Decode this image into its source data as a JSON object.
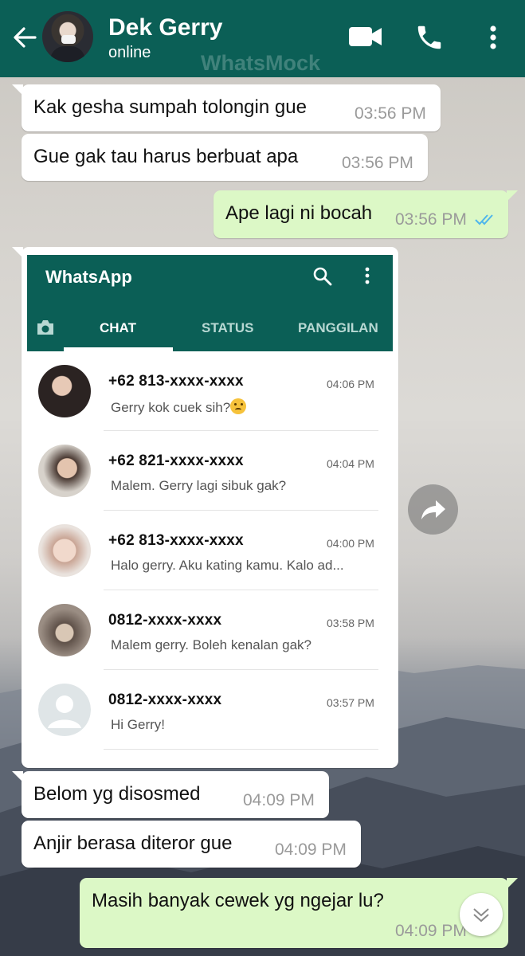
{
  "header": {
    "contact_name": "Dek Gerry",
    "status": "online",
    "watermark": "WhatsMock",
    "bg_color": "#0b5f56",
    "icons": [
      "back-arrow-icon",
      "video-call-icon",
      "voice-call-icon",
      "more-vert-icon"
    ]
  },
  "messages": [
    {
      "dir": "in",
      "text": "Kak gesha sumpah tolongin gue",
      "time": "03:56 PM"
    },
    {
      "dir": "in",
      "text": "Gue gak tau harus berbuat apa",
      "time": "03:56 PM"
    },
    {
      "dir": "out",
      "text": "Ape lagi ni bocah",
      "time": "03:56 PM",
      "read": true
    },
    {
      "dir": "in",
      "type": "image",
      "description_none": ""
    },
    {
      "dir": "in",
      "text": "Belom yg disosmed",
      "time": "04:09 PM"
    },
    {
      "dir": "in",
      "text": "Anjir berasa diteror gue",
      "time": "04:09 PM"
    },
    {
      "dir": "out",
      "text": "Masih banyak cewek yg ngejar lu?",
      "time": "04:09 PM"
    }
  ],
  "screenshot": {
    "app_title": "WhatsApp",
    "tabs": [
      "CHAT",
      "STATUS",
      "PANGGILAN"
    ],
    "active_tab": "CHAT",
    "chats": [
      {
        "name": "+62 813-xxxx-xxxx",
        "time": "04:06 PM",
        "message": "Gerry kok cuek sih?",
        "emoji": "frowning-face"
      },
      {
        "name": "+62 821-xxxx-xxxx",
        "time": "04:04 PM",
        "message": "Malem. Gerry lagi sibuk gak?"
      },
      {
        "name": "+62 813-xxxx-xxxx",
        "time": "04:00 PM",
        "message": "Halo gerry. Aku kating kamu. Kalo ad..."
      },
      {
        "name": "0812-xxxx-xxxx",
        "time": "03:58 PM",
        "message": "Malem gerry. Boleh kenalan gak?"
      },
      {
        "name": "0812-xxxx-xxxx",
        "time": "03:57 PM",
        "message": "Hi Gerry!"
      }
    ]
  },
  "colors": {
    "header": "#0b5f56",
    "incoming": "#ffffff",
    "outgoing": "#dcf8c6",
    "read_ticks": "#4fb6ec"
  }
}
